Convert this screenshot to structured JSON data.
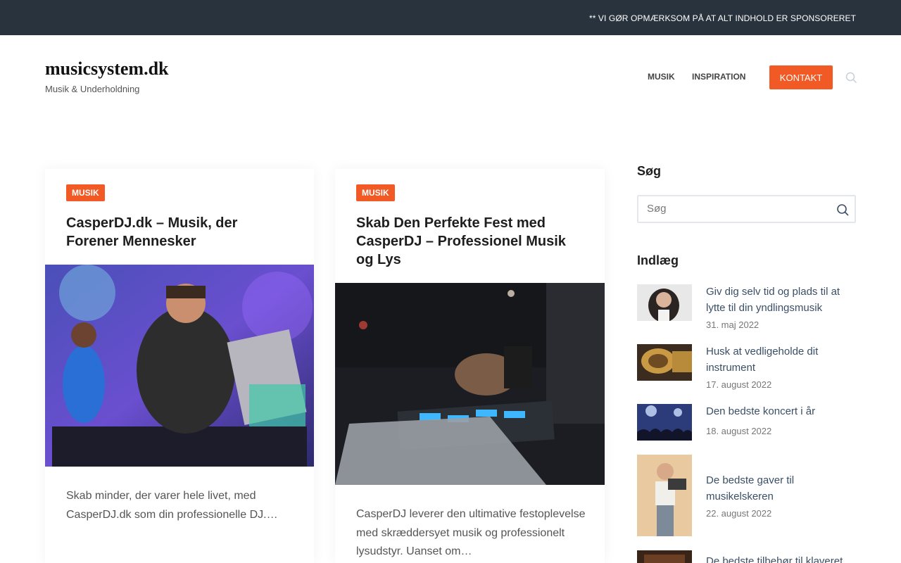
{
  "topbar": {
    "text": "** VI GØR OPMÆRKSOM PÅ AT ALT INDHOLD ER SPONSORERET"
  },
  "header": {
    "site_title": "musicsystem.dk",
    "tagline": "Musik & Underholdning",
    "nav": {
      "musik": "MUSIK",
      "inspiration": "INSPIRATION",
      "kontakt": "KONTAKT"
    }
  },
  "colors": {
    "accent": "#f15a24",
    "topbar": "#29333d"
  },
  "articles": [
    {
      "category": "MUSIK",
      "title": "CasperDJ.dk – Musik, der Forener Mennesker",
      "excerpt": "Skab minder, der varer hele livet, med CasperDJ.dk som din professionelle DJ.…"
    },
    {
      "category": "MUSIK",
      "title": "Skab Den Perfekte Fest med CasperDJ – Professionel Musik og Lys",
      "excerpt": "CasperDJ leverer den ultimative festoplevelse med skræddersyet musik og professionelt lysudstyr. Uanset om…"
    }
  ],
  "sidebar": {
    "search_heading": "Søg",
    "search_placeholder": "Søg",
    "posts_heading": "Indlæg",
    "posts": [
      {
        "title": "Giv dig selv tid og plads til at lytte til din yndlingsmusik",
        "date": "31. maj 2022"
      },
      {
        "title": "Husk at vedligeholde dit instrument",
        "date": "17. august 2022"
      },
      {
        "title": "Den bedste koncert i år",
        "date": "18. august 2022"
      },
      {
        "title": "De bedste gaver til musikelskeren",
        "date": "22. august 2022"
      },
      {
        "title": "De bedste tilbehør til klaveret",
        "date": ""
      }
    ]
  }
}
